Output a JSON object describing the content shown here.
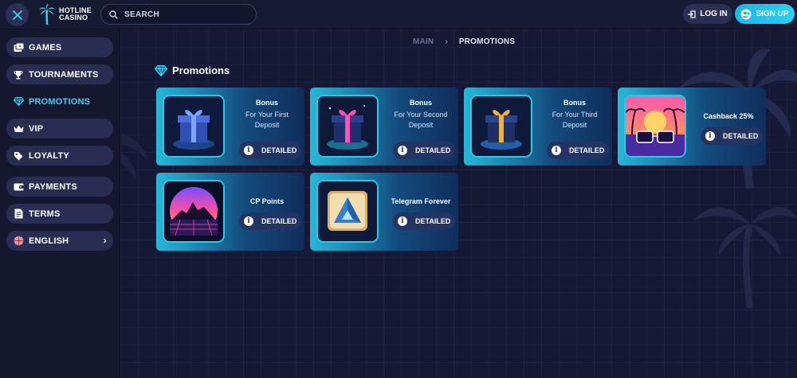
{
  "header": {
    "brand_line1": "HOTLINE",
    "brand_line2": "CASINO",
    "search_placeholder": "SEARCH",
    "login_label": "LOG IN",
    "signup_label": "SIGN UP"
  },
  "sidebar": {
    "items": [
      {
        "label": "GAMES",
        "icon": "games-icon"
      },
      {
        "label": "TOURNAMENTS",
        "icon": "trophy-icon"
      },
      {
        "label": "PROMOTIONS",
        "icon": "diamond-icon",
        "active": true
      },
      {
        "label": "VIP",
        "icon": "crown-icon"
      },
      {
        "label": "LOYALTY",
        "icon": "tag-icon"
      },
      {
        "label": "PAYMENTS",
        "icon": "wallet-icon"
      },
      {
        "label": "TERMS",
        "icon": "document-icon"
      },
      {
        "label": "ENGLISH",
        "icon": "uk-flag-icon"
      }
    ]
  },
  "breadcrumb": {
    "first": "MAIN",
    "separator": "›",
    "current": "PROMOTIONS"
  },
  "page": {
    "title": "Promotions"
  },
  "promotions": [
    {
      "title": "Bonus",
      "sub1": "For Your First",
      "sub2": "Deposit",
      "button": "DETAILED",
      "image": "blue-gift-box"
    },
    {
      "title": "Bonus",
      "sub1": "For Your Second",
      "sub2": "Deposit",
      "button": "DETAILED",
      "image": "pink-gift-box"
    },
    {
      "title": "Bonus",
      "sub1": "For Your Third",
      "sub2": "Deposit",
      "button": "DETAILED",
      "image": "gold-gift-box"
    },
    {
      "title": "Cashback 25%",
      "button": "DETAILED",
      "image": "retro-sunset-glasses"
    },
    {
      "title": "CP Points",
      "button": "DETAILED",
      "image": "synthwave-sun"
    },
    {
      "title": "Telegram Forever",
      "button": "DETAILED",
      "image": "telegram-triangle"
    }
  ],
  "colors": {
    "accent": "#27d0f5",
    "active_nav": "#3fd2f0",
    "background": "#161935"
  }
}
